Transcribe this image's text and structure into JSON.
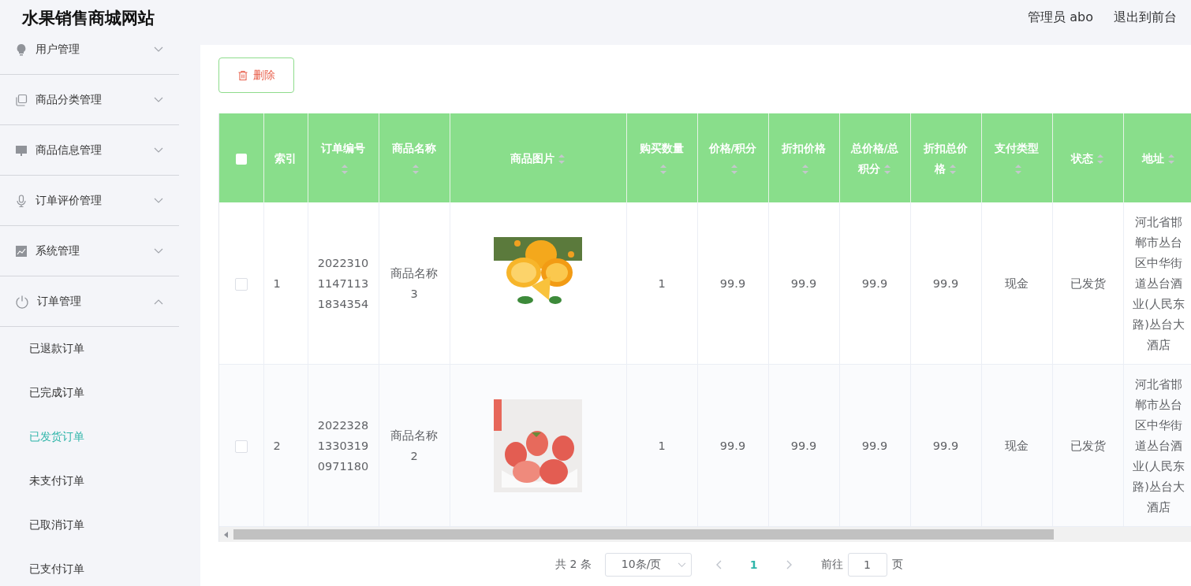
{
  "header": {
    "title": "水果销售商城网站",
    "user": "管理员 abo",
    "exit_link": "退出到前台"
  },
  "sidebar": {
    "menus": [
      {
        "kind": "bulb",
        "label": "用户管理",
        "expanded": false
      },
      {
        "kind": "copy",
        "label": "商品分类管理",
        "expanded": false
      },
      {
        "kind": "monitor",
        "label": "商品信息管理",
        "expanded": false
      },
      {
        "kind": "mic",
        "label": "订单评价管理",
        "expanded": false
      },
      {
        "kind": "chart",
        "label": "系统管理",
        "expanded": false
      },
      {
        "kind": "power",
        "label": "订单管理",
        "expanded": true,
        "children": [
          {
            "label": "已退款订单",
            "selected": false
          },
          {
            "label": "已完成订单",
            "selected": false
          },
          {
            "label": "已发货订单",
            "selected": true
          },
          {
            "label": "未支付订单",
            "selected": false
          },
          {
            "label": "已取消订单",
            "selected": false
          },
          {
            "label": "已支付订单",
            "selected": false
          }
        ]
      }
    ]
  },
  "toolbar": {
    "delete_button": "删除"
  },
  "table": {
    "select_all_checked": false,
    "columns": [
      {
        "label": "索引",
        "sortable": false
      },
      {
        "label": "订单编号",
        "sortable": true
      },
      {
        "label": "商品名称",
        "sortable": true
      },
      {
        "label": "商品图片",
        "sortable": true
      },
      {
        "label": "购买数量",
        "sortable": true
      },
      {
        "label": "价格/积分",
        "sortable": true
      },
      {
        "label": "折扣价格",
        "sortable": true
      },
      {
        "label": "总价格/总积分",
        "sortable": true
      },
      {
        "label": "折扣总价格",
        "sortable": true
      },
      {
        "label": "支付类型",
        "sortable": true
      },
      {
        "label": "状态",
        "sortable": true
      },
      {
        "label": "地址",
        "sortable": true
      }
    ],
    "rows": [
      {
        "selected": false,
        "index": "1",
        "order_no": "202231011471131834354",
        "product": "商品名称3",
        "quantity": "1",
        "price": "99.9",
        "discount_price": "99.9",
        "total": "99.9",
        "discount_total": "99.9",
        "payment": "现金",
        "status": "已发货",
        "address": "河北省邯郸市丛台区中华街道丛台酒业(人民东路)丛台大酒店"
      },
      {
        "selected": false,
        "index": "2",
        "order_no": "202232813303190971180",
        "product": "商品名称2",
        "quantity": "1",
        "price": "99.9",
        "discount_price": "99.9",
        "total": "99.9",
        "discount_total": "99.9",
        "payment": "现金",
        "status": "已发货",
        "address": "河北省邯郸市丛台区中华街道丛台酒业(人民东路)丛台大酒店"
      }
    ]
  },
  "pagination": {
    "total": "共 2 条",
    "page_size": "10条/页",
    "current_page": "1",
    "goto_label": "前往",
    "goto_value": "1",
    "page_unit": "页"
  }
}
